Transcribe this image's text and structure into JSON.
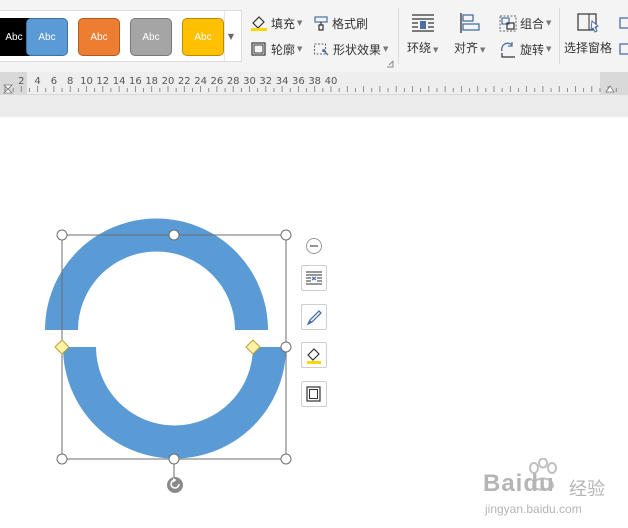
{
  "styles": {
    "swatches": [
      {
        "label": "Abc",
        "fill": "#000000",
        "border": "#000000"
      },
      {
        "label": "Abc",
        "fill": "#5b9bd5",
        "border": "#41719c"
      },
      {
        "label": "Abc",
        "fill": "#ed7d31",
        "border": "#ae5a21"
      },
      {
        "label": "Abc",
        "fill": "#a5a5a5",
        "border": "#787878"
      },
      {
        "label": "Abc",
        "fill": "#ffc000",
        "border": "#bc8c00"
      }
    ],
    "more_icon": "chevron-down-icon"
  },
  "toolbar": {
    "fill_label": "填充",
    "format_painter_label": "格式刷",
    "outline_label": "轮廓",
    "shape_effects_label": "形状效果",
    "wrap_label": "环绕",
    "align_label": "对齐",
    "group_label": "组合",
    "rotate_label": "旋转",
    "selection_pane_label": "选择窗格"
  },
  "ruler": {
    "labels": [
      "2",
      "4",
      "6",
      "8",
      "10",
      "12",
      "14",
      "16",
      "18",
      "20",
      "22",
      "24",
      "26",
      "28",
      "30",
      "32",
      "34",
      "36",
      "38",
      "40"
    ]
  },
  "shape": {
    "fill": "#5b9bd5",
    "handle_fill": "#fff2a8",
    "handle_stroke": "#b9a13a"
  },
  "float_toolbar": {
    "icons": [
      "collapse-icon",
      "layout-options-icon",
      "shape-style-icon",
      "shape-fill-icon",
      "shape-outline-icon"
    ]
  },
  "watermark": {
    "brand": "Baidu",
    "cn": "经验",
    "url": "jingyan.baidu.com"
  },
  "colors": {
    "accent": "#5b9bd5",
    "icon": "#4a6fa5"
  }
}
